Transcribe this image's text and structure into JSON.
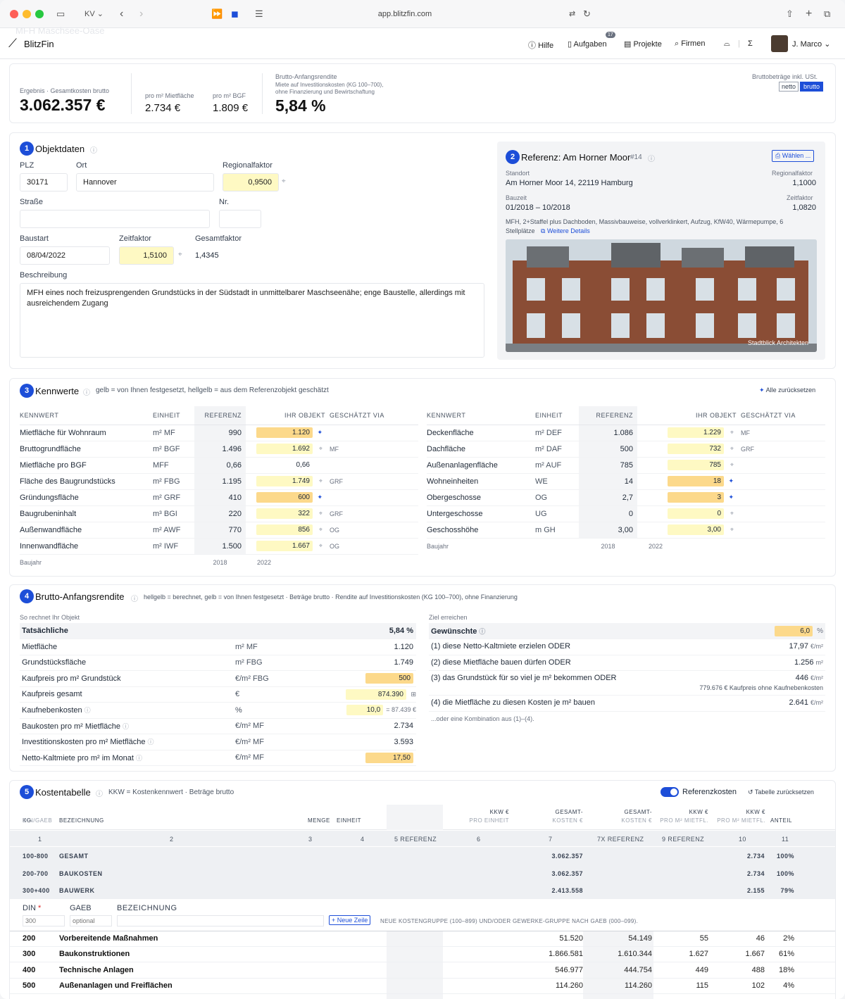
{
  "browser": {
    "url": "app.blitzfin.com",
    "mode": "KV"
  },
  "app": {
    "logo": "BlitzFin",
    "ghost_title": "MFH Maschsee-Oase",
    "nav": {
      "help": "Hilfe",
      "tasks": "Aufgaben",
      "tasks_badge": "17",
      "projects": "Projekte",
      "companies": "Firmen",
      "sigma": "Σ",
      "user": "J. Marco"
    }
  },
  "summary": {
    "result_label": "Ergebnis · Gesamtkosten brutto",
    "result_value": "3.062.357 €",
    "per_mf_label": "pro m² Mietfläche",
    "per_mf_value": "2.734 €",
    "per_bgf_label": "pro m² BGF",
    "per_bgf_value": "1.809 €",
    "bar_title": "Brutto-Anfangsrendite",
    "bar_sub1": "Miete auf Investitionskosten (KG 100–700),",
    "bar_sub2": "ohne Finanzierung und Bewirtschaftung",
    "bar_value": "5,84 %",
    "toggle_label": "Bruttobeträge inkl. USt.",
    "netto": "netto",
    "brutto": "brutto"
  },
  "objekt": {
    "num": "1",
    "title": "Objektdaten",
    "plz_label": "PLZ",
    "plz": "30171",
    "ort_label": "Ort",
    "ort": "Hannover",
    "rf_label": "Regionalfaktor",
    "rf": "0,9500",
    "strasse_label": "Straße",
    "strasse": "",
    "nr_label": "Nr.",
    "nr": "",
    "baustart_label": "Baustart",
    "baustart": "08/04/2022",
    "zf_label": "Zeitfaktor",
    "zf": "1,5100",
    "gf_label": "Gesamtfaktor",
    "gf": "1,4345",
    "desc_label": "Beschreibung",
    "desc": "MFH eines noch freizusprengenden Grundstücks in der Südstadt in unmittelbarer Maschseenähe; enge Baustelle, allerdings mit ausreichendem Zugang"
  },
  "referenz": {
    "num": "2",
    "title": "Referenz: Am Horner Moor",
    "tag": "#14",
    "choose": "Wählen ...",
    "standort_label": "Standort",
    "standort": "Am Horner Moor 14, 22119 Hamburg",
    "rf_label": "Regionalfaktor",
    "rf": "1,1000",
    "bauzeit_label": "Bauzeit",
    "bauzeit": "01/2018 – 10/2018",
    "zf_label": "Zeitfaktor",
    "zf": "1,0820",
    "desc": "MFH, 2+Staffel plus Dachboden, Massivbauweise, vollverklinkert, Aufzug, KfW40, Wärmepumpe, 6",
    "desc2": "Stellplätze",
    "more": "Weitere Details",
    "credit": "Stadtblick Architekten"
  },
  "kennwerte": {
    "num": "3",
    "title": "Kennwerte",
    "hint": "gelb = von Ihnen festgesetzt, hellgelb = aus dem Referenzobjekt geschätzt",
    "reset": "Alle zurücksetzen",
    "headers": [
      "KENNWERT",
      "EINHEIT",
      "REFERENZ",
      "IHR OBJEKT",
      "GESCHÄTZT VIA"
    ],
    "left": [
      [
        "Mietfläche für Wohnraum",
        "m² MF",
        "990",
        "1.120",
        "pin",
        ""
      ],
      [
        "Bruttogrundfläche",
        "m² BGF",
        "1.496",
        "1.692",
        "link",
        "MF"
      ],
      [
        "Mietfläche pro BGF",
        "MFF",
        "0,66",
        "0,66",
        "none",
        ""
      ],
      [
        "Fläche des Baugrundstücks",
        "m² FBG",
        "1.195",
        "1.749",
        "link",
        "GRF"
      ],
      [
        "Gründungsfläche",
        "m² GRF",
        "410",
        "600",
        "pin",
        ""
      ],
      [
        "Baugrubeninhalt",
        "m³ BGI",
        "220",
        "322",
        "link",
        "GRF"
      ],
      [
        "Außenwandfläche",
        "m² AWF",
        "770",
        "856",
        "link",
        "OG"
      ],
      [
        "Innenwandfläche",
        "m² IWF",
        "1.500",
        "1.667",
        "link",
        "OG"
      ]
    ],
    "left_foot": [
      "Baujahr",
      "2018",
      "2022"
    ],
    "right": [
      [
        "Deckenfläche",
        "m² DEF",
        "1.086",
        "1.229",
        "link",
        "MF"
      ],
      [
        "Dachfläche",
        "m² DAF",
        "500",
        "732",
        "link",
        "GRF"
      ],
      [
        "Außenanlagenfläche",
        "m² AUF",
        "785",
        "785",
        "link",
        ""
      ],
      [
        "Wohneinheiten",
        "WE",
        "14",
        "18",
        "pin",
        ""
      ],
      [
        "Obergeschosse",
        "OG",
        "2,7",
        "3",
        "pin",
        ""
      ],
      [
        "Untergeschosse",
        "UG",
        "0",
        "0",
        "link",
        ""
      ],
      [
        "Geschosshöhe",
        "m GH",
        "3,00",
        "3,00",
        "link",
        ""
      ]
    ],
    "right_foot": [
      "Baujahr",
      "2018",
      "2022"
    ]
  },
  "rendite": {
    "num": "4",
    "title": "Brutto-Anfangsrendite",
    "hint": "hellgelb = berechnet, gelb = von Ihnen festgesetzt · Beträge brutto · Rendite auf Investitionskosten (KG 100–700), ohne Finanzierung",
    "left_caption": "So rechnet Ihr Objekt",
    "left_head": [
      "Tatsächliche",
      "5,84 %"
    ],
    "left_rows": [
      [
        "Mietfläche",
        "m² MF",
        "1.120",
        ""
      ],
      [
        "Grundstücksfläche",
        "m² FBG",
        "1.749",
        ""
      ],
      [
        "Kaufpreis pro m² Grundstück",
        "€/m² FBG",
        "500",
        "y"
      ],
      [
        "Kaufpreis gesamt",
        "€",
        "874.390",
        "ly"
      ],
      [
        "Kaufnebenkosten",
        "%",
        "10,0",
        "ly"
      ],
      [
        "Baukosten pro m² Mietfläche",
        "€/m² MF",
        "2.734",
        ""
      ],
      [
        "Investitionskosten pro m² Mietfläche",
        "€/m² MF",
        "3.593",
        ""
      ],
      [
        "Netto-Kaltmiete pro m² im Monat",
        "€/m² MF",
        "17,50",
        "y"
      ]
    ],
    "knk_extra": "= 87.439 €",
    "right_caption": "Ziel erreichen",
    "right_head": [
      "Gewünschte",
      "6,0",
      "%"
    ],
    "right_rows": [
      [
        "(1) diese Netto-Kaltmiete erzielen ODER",
        "17,97",
        "€/m²"
      ],
      [
        "(2) diese Mietfläche bauen dürfen ODER",
        "1.256",
        "m²"
      ],
      [
        "(3) das Grundstück für so viel je m² bekommen ODER",
        "446",
        "€/m²"
      ],
      [
        "(4) die Mietfläche zu diesen Kosten je m² bauen",
        "2.641",
        "€/m²"
      ]
    ],
    "row3_note": "779.676 € Kaufpreis ohne Kaufnebenkosten",
    "combo": "...oder eine Kombination aus (1)–(4)."
  },
  "kosten": {
    "num": "5",
    "title": "Kostentabelle",
    "hint": "KKW = Kostenkennwert · Beträge brutto",
    "toggle": "Referenzkosten",
    "reset": "Tabelle zurücksetzen",
    "headers": [
      "KG",
      "DIN/GAEB",
      "BEZEICHNUNG",
      "MENGE",
      "EINHEIT",
      "KKW €",
      "PRO EINHEIT",
      "KKW €",
      "PRO EINHEIT",
      "GESAMT-",
      "KOSTEN €",
      "GESAMT-",
      "KOSTEN €",
      "KKW €",
      "PRO M² MIETFL.",
      "KKW €",
      "PRO M² MIETFL.",
      "ANTEIL"
    ],
    "colnums": [
      "1",
      "2",
      "3",
      "4",
      "5 REFERENZ",
      "6",
      "7",
      "7X REFERENZ",
      "9 REFERENZ",
      "10",
      "11"
    ],
    "summary": [
      [
        "100-800",
        "GESAMT",
        "3.062.357",
        "2.734",
        "100%"
      ],
      [
        "200-700",
        "BAUKOSTEN",
        "3.062.357",
        "2.734",
        "100%"
      ],
      [
        "300+400",
        "BAUWERK",
        "2.413.558",
        "2.155",
        "79%"
      ]
    ],
    "add": {
      "din": "DIN",
      "gaeb": "GAEB",
      "bez": "BEZEICHNUNG",
      "din_ph": "300",
      "gaeb_ph": "optional",
      "button": "+ Neue Zeile",
      "note": "NEUE KOSTENGRUPPE (100–899) UND/ODER GEWERKE-GRUPPE NACH GAEB (000–099)."
    },
    "rows": [
      [
        "200",
        "Vorbereitende Maßnahmen",
        "51.520",
        "54.149",
        "55",
        "46",
        "2%"
      ],
      [
        "300",
        "Baukonstruktionen",
        "1.866.581",
        "1.610.344",
        "1.627",
        "1.667",
        "61%"
      ],
      [
        "400",
        "Technische Anlagen",
        "546.977",
        "444.754",
        "449",
        "488",
        "18%"
      ],
      [
        "500",
        "Außenanlagen und Freiflächen",
        "114.260",
        "114.260",
        "115",
        "102",
        "4%"
      ]
    ]
  },
  "colors": {
    "accent": "#1d4ed8",
    "yellow": "#fcd98b",
    "lightyellow": "#fef9c3"
  }
}
